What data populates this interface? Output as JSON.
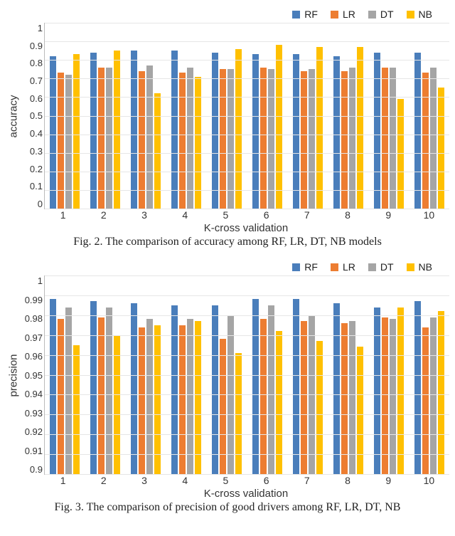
{
  "colors": {
    "RF": "#4A7EBB",
    "LR": "#ED7D31",
    "DT": "#A5A5A5",
    "NB": "#FFC000"
  },
  "series_order": [
    "RF",
    "LR",
    "DT",
    "NB"
  ],
  "captions": {
    "fig2": "Fig. 2. The comparison of accuracy among RF, LR, DT, NB models",
    "fig3": "Fig. 3. The comparison of precision of good drivers among RF, LR, DT, NB"
  },
  "xlabel": "K-cross validation",
  "chart_data": [
    {
      "id": "fig2",
      "type": "bar",
      "ylabel": "accuracy",
      "xlabel": "K-cross validation",
      "categories": [
        "1",
        "2",
        "3",
        "4",
        "5",
        "6",
        "7",
        "8",
        "9",
        "10"
      ],
      "ylim": [
        0,
        1
      ],
      "yticks": [
        "1",
        "0.9",
        "0.8",
        "0.7",
        "0.6",
        "0.5",
        "0.4",
        "0.3",
        "0.2",
        "0.1",
        "0"
      ],
      "legend": [
        "RF",
        "LR",
        "DT",
        "NB"
      ],
      "series": [
        {
          "name": "RF",
          "values": [
            0.82,
            0.84,
            0.85,
            0.85,
            0.84,
            0.83,
            0.83,
            0.82,
            0.84,
            0.84
          ]
        },
        {
          "name": "LR",
          "values": [
            0.73,
            0.76,
            0.74,
            0.73,
            0.75,
            0.76,
            0.74,
            0.74,
            0.76,
            0.73
          ]
        },
        {
          "name": "DT",
          "values": [
            0.72,
            0.76,
            0.77,
            0.76,
            0.75,
            0.75,
            0.75,
            0.76,
            0.76,
            0.76
          ]
        },
        {
          "name": "NB",
          "values": [
            0.83,
            0.85,
            0.62,
            0.71,
            0.86,
            0.88,
            0.87,
            0.87,
            0.59,
            0.65
          ]
        }
      ]
    },
    {
      "id": "fig3",
      "type": "bar",
      "ylabel": "precision",
      "xlabel": "K-cross validation",
      "categories": [
        "1",
        "2",
        "3",
        "4",
        "5",
        "6",
        "7",
        "8",
        "9",
        "10"
      ],
      "ylim": [
        0.9,
        1
      ],
      "yticks": [
        "1",
        "0.99",
        "0.98",
        "0.97",
        "0.96",
        "0.95",
        "0.94",
        "0.93",
        "0.92",
        "0.91",
        "0.9"
      ],
      "legend": [
        "RF",
        "LR",
        "DT",
        "NB"
      ],
      "series": [
        {
          "name": "RF",
          "values": [
            0.988,
            0.987,
            0.986,
            0.985,
            0.985,
            0.988,
            0.988,
            0.986,
            0.984,
            0.987
          ]
        },
        {
          "name": "LR",
          "values": [
            0.978,
            0.979,
            0.974,
            0.975,
            0.968,
            0.978,
            0.977,
            0.976,
            0.979,
            0.974
          ]
        },
        {
          "name": "DT",
          "values": [
            0.984,
            0.984,
            0.978,
            0.978,
            0.98,
            0.985,
            0.98,
            0.977,
            0.978,
            0.979
          ]
        },
        {
          "name": "NB",
          "values": [
            0.965,
            0.97,
            0.975,
            0.977,
            0.961,
            0.972,
            0.967,
            0.964,
            0.984,
            0.982
          ]
        }
      ]
    }
  ]
}
